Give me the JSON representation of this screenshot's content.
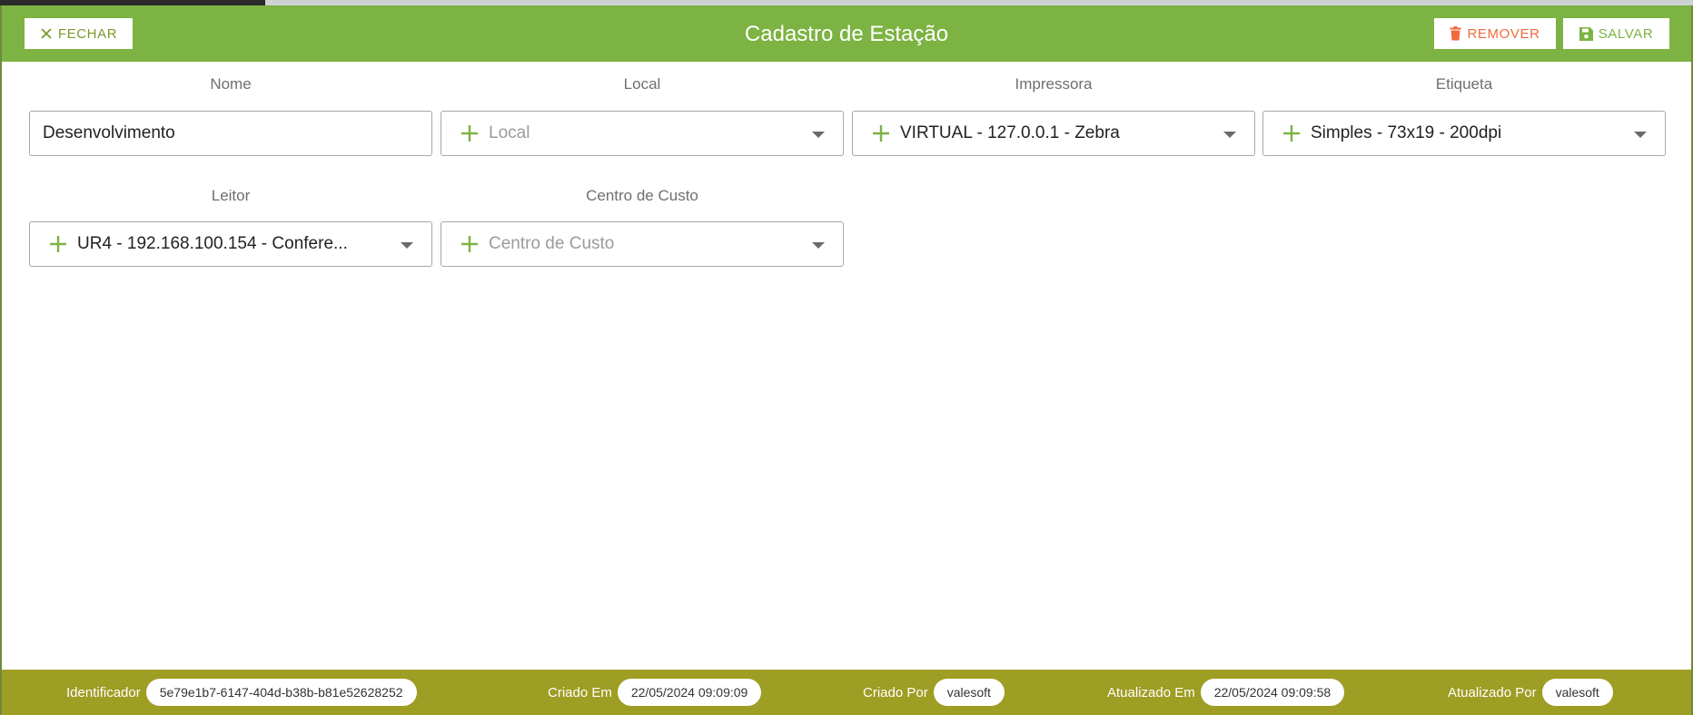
{
  "dialog": {
    "title": "Cadastro de Estação",
    "close_label": "FECHAR",
    "remove_label": "REMOVER",
    "save_label": "SALVAR"
  },
  "form": {
    "nome": {
      "label": "Nome",
      "value": "Desenvolvimento"
    },
    "local": {
      "label": "Local",
      "placeholder": "Local"
    },
    "impressora": {
      "label": "Impressora",
      "value": "VIRTUAL - 127.0.0.1 - Zebra"
    },
    "etiqueta": {
      "label": "Etiqueta",
      "value": "Simples - 73x19 - 200dpi"
    },
    "leitor": {
      "label": "Leitor",
      "value": "UR4 - 192.168.100.154 - Confere..."
    },
    "centro_custo": {
      "label": "Centro de Custo",
      "placeholder": "Centro de Custo"
    }
  },
  "footer": {
    "identificador": {
      "label": "Identificador",
      "value": "5e79e1b7-6147-404d-b38b-b81e52628252"
    },
    "criado_em": {
      "label": "Criado Em",
      "value": "22/05/2024 09:09:09"
    },
    "criado_por": {
      "label": "Criado Por",
      "value": "valesoft"
    },
    "atualizado_em": {
      "label": "Atualizado Em",
      "value": "22/05/2024 09:09:58"
    },
    "atualizado_por": {
      "label": "Atualizado Por",
      "value": "valesoft"
    }
  },
  "colors": {
    "header": "#7cb342",
    "footer": "#9e9d24",
    "remove": "#f06a3c",
    "accent": "#7cb342"
  },
  "icons": {
    "close": "close-icon",
    "remove": "trash-icon",
    "save": "save-icon",
    "add": "plus-icon",
    "dropdown": "caret-down-icon"
  }
}
